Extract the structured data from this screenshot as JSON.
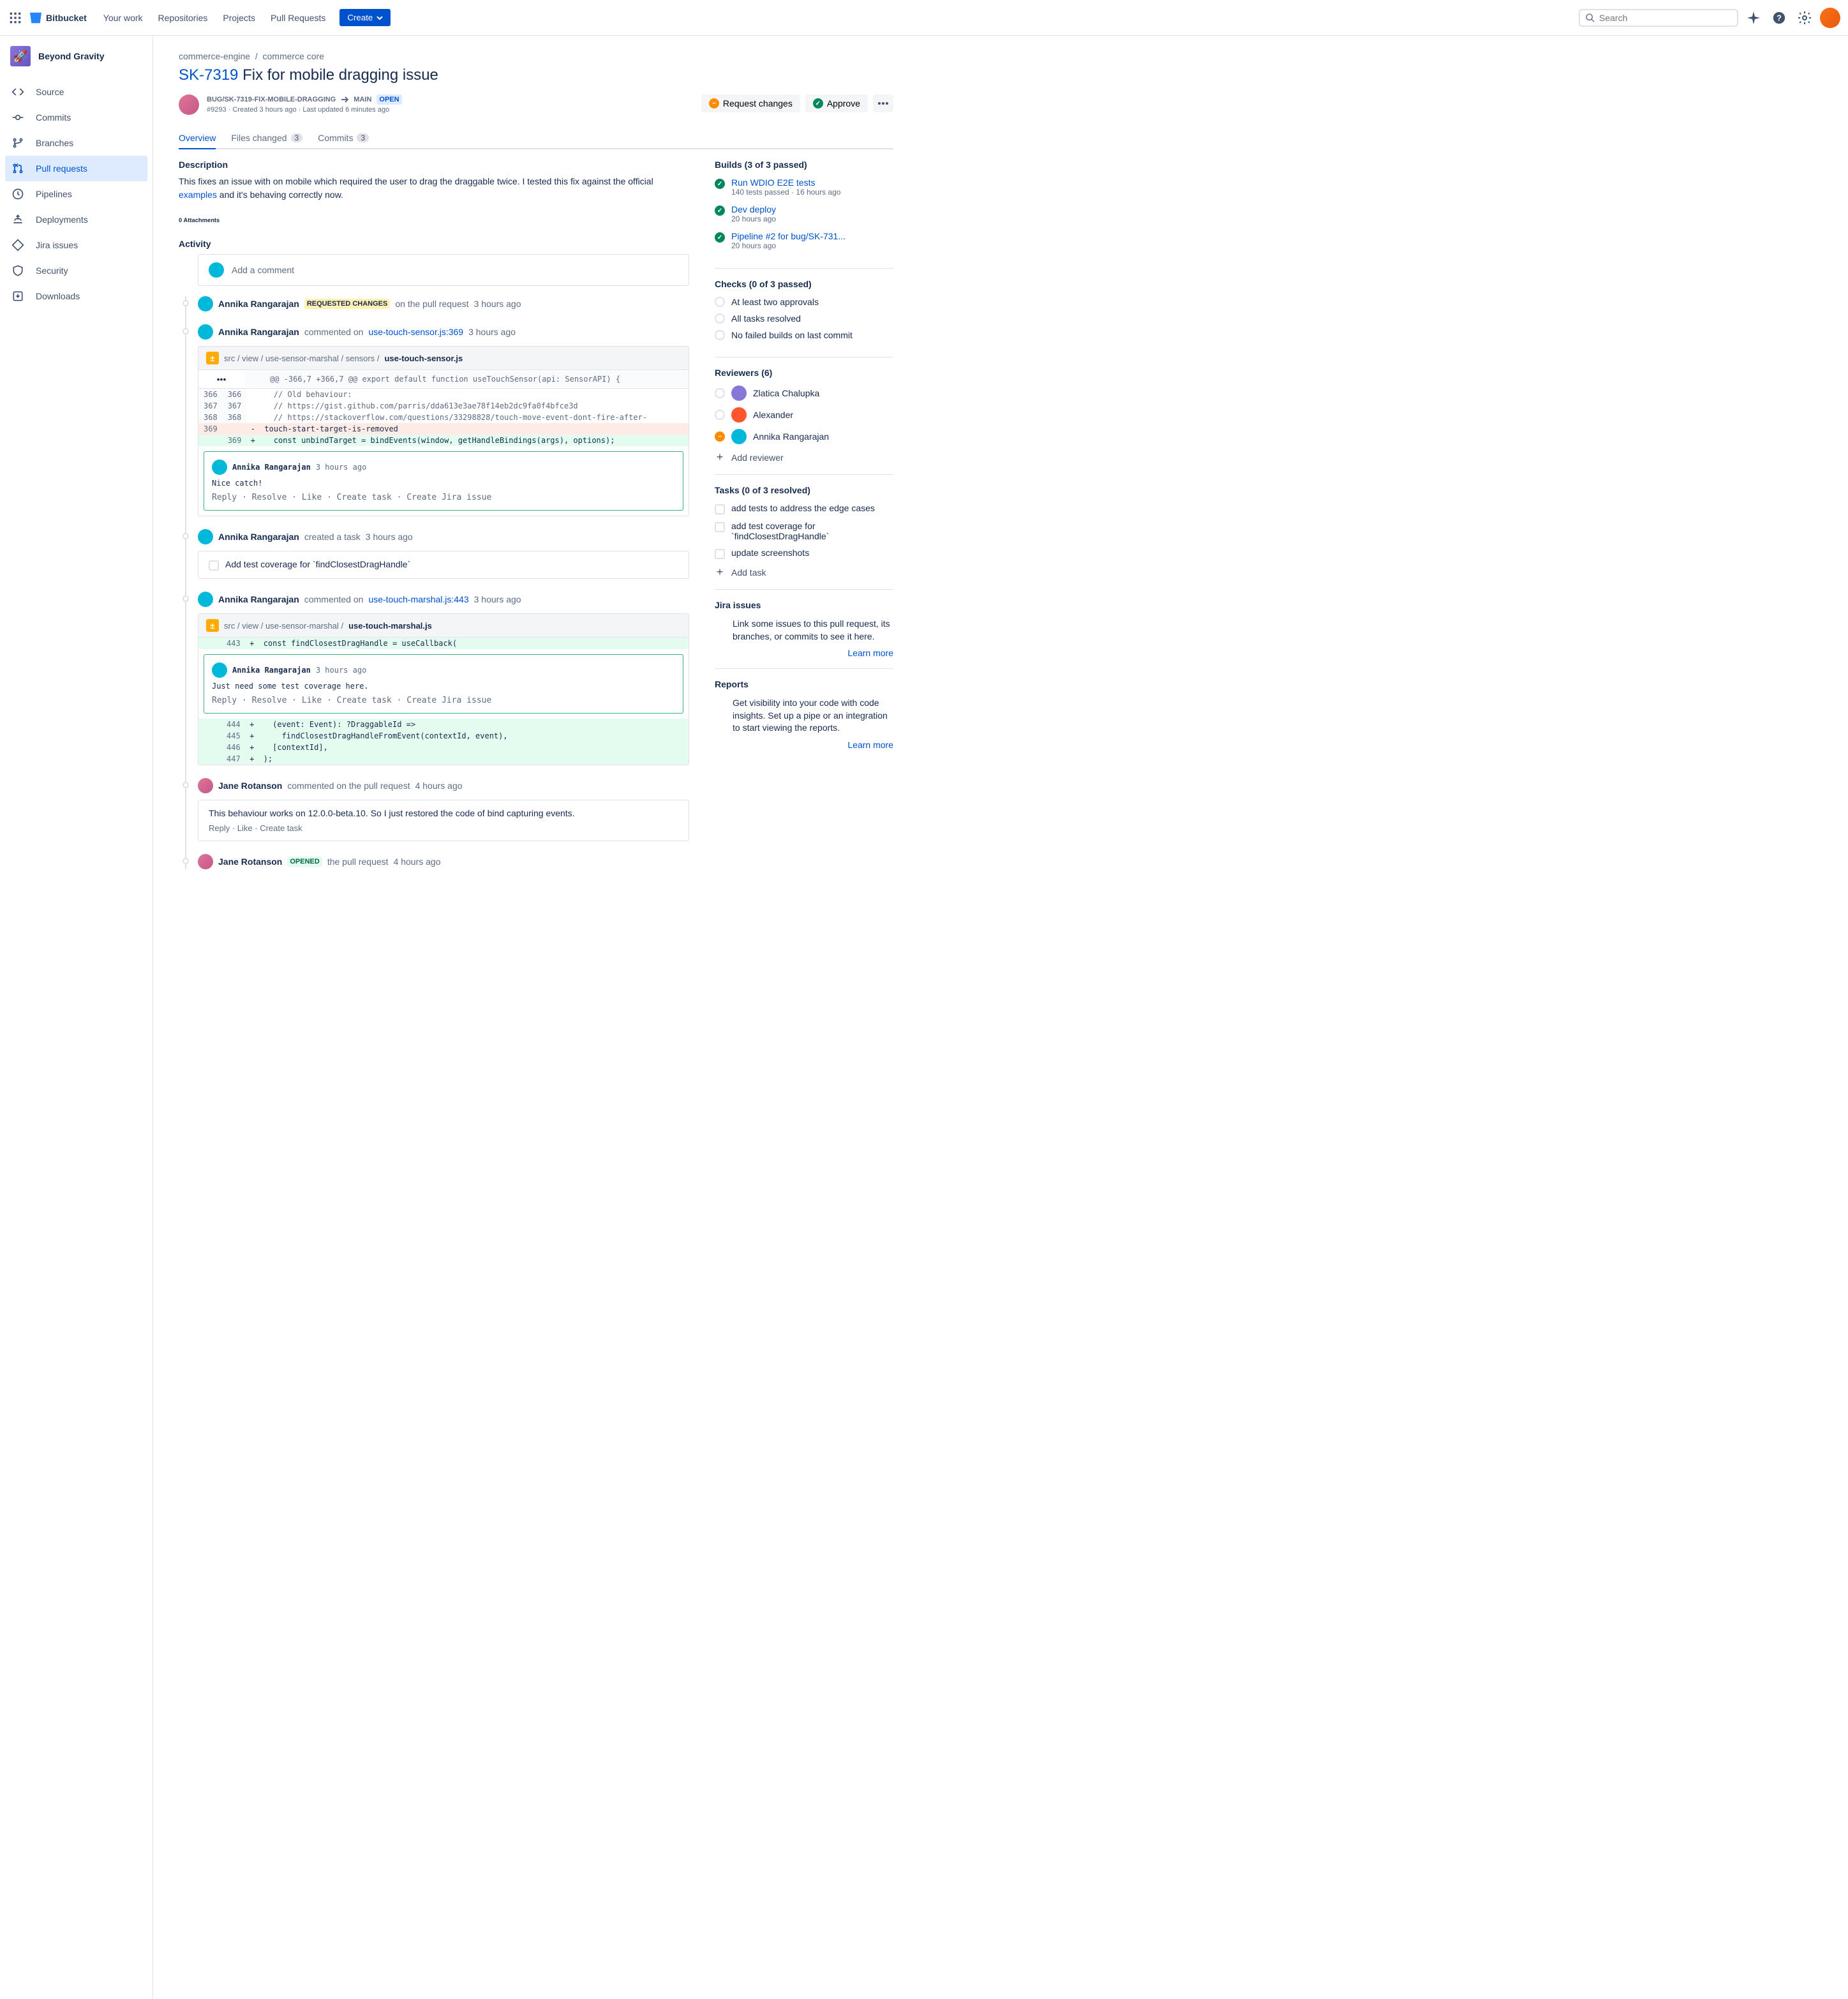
{
  "topnav": {
    "product": "Bitbucket",
    "links": [
      "Your work",
      "Repositories",
      "Projects",
      "Pull Requests"
    ],
    "create": "Create",
    "search_placeholder": "Search"
  },
  "sidebar": {
    "project": "Beyond Gravity",
    "items": [
      {
        "label": "Source",
        "icon": "code"
      },
      {
        "label": "Commits",
        "icon": "commit"
      },
      {
        "label": "Branches",
        "icon": "branch"
      },
      {
        "label": "Pull requests",
        "icon": "pr",
        "active": true
      },
      {
        "label": "Pipelines",
        "icon": "pipeline"
      },
      {
        "label": "Deployments",
        "icon": "deploy"
      },
      {
        "label": "Jira issues",
        "icon": "jira"
      },
      {
        "label": "Security",
        "icon": "security"
      },
      {
        "label": "Downloads",
        "icon": "download"
      }
    ]
  },
  "breadcrumb": {
    "repo": "commerce-engine",
    "pkg": "commerce core"
  },
  "pr": {
    "key": "SK-7319",
    "title": "Fix for mobile dragging issue",
    "branch_source": "BUG/SK-7319-FIX-MOBILE-DRAGGING",
    "branch_dest": "MAIN",
    "state": "OPEN",
    "id_line": "#9293 · Created 3 hours ago · Last updated 6 minutes ago",
    "actions": {
      "request": "Request changes",
      "approve": "Approve"
    }
  },
  "tabs": {
    "overview": "Overview",
    "files": "Files changed",
    "files_count": "3",
    "commits": "Commits",
    "commits_count": "3"
  },
  "description": {
    "heading": "Description",
    "text_pre": "This fixes an issue with on mobile which required the user to drag the draggable twice. I tested this fix against the official ",
    "link": "examples",
    "text_post": " and it's behaving correctly now."
  },
  "attachments": "0 Attachments",
  "activity_heading": "Activity",
  "add_comment": "Add a comment",
  "activity": [
    {
      "author": "Annika Rangarajan",
      "badge": "REQUESTED CHANGES",
      "tail": "on the pull request",
      "time": "3 hours ago"
    },
    {
      "author": "Annika Rangarajan",
      "action": "commented on",
      "link": "use-touch-sensor.js:369",
      "time": "3 hours ago",
      "file_path": "src / view / use-sensor-marshal / sensors / ",
      "file_name": "use-touch-sensor.js",
      "hunk": "@@ -366,7 +366,7 @@ export default function useTouchSensor(api: SensorAPI) {",
      "rows": [
        {
          "l": "366",
          "r": "366",
          "t": "ctx",
          "code": "  // Old behaviour:"
        },
        {
          "l": "367",
          "r": "367",
          "t": "ctx",
          "code": "  // https://gist.github.com/parris/dda613e3ae78f14eb2dc9fa0f4bfce3d"
        },
        {
          "l": "368",
          "r": "368",
          "t": "ctx",
          "code": "  // https://stackoverflow.com/questions/33298828/touch-move-event-dont-fire-after-"
        },
        {
          "l": "369",
          "r": "",
          "t": "del",
          "code": "touch-start-target-is-removed"
        },
        {
          "l": "",
          "r": "369",
          "t": "add",
          "code": "  const unbindTarget = bindEvents(window, getHandleBindings(args), options);"
        }
      ],
      "comment": {
        "author": "Annika Rangarajan",
        "time": "3 hours ago",
        "body": "Nice catch!",
        "actions": "Reply · Resolve · Like · Create task · Create Jira issue"
      }
    },
    {
      "author": "Annika Rangarajan",
      "action": "created a task",
      "time": "3 hours ago",
      "task": "Add test coverage for `findClosestDragHandle`"
    },
    {
      "author": "Annika Rangarajan",
      "action": "commented on",
      "link": "use-touch-marshal.js:443",
      "time": "3 hours ago",
      "file_path": "src / view / use-sensor-marshal / ",
      "file_name": "use-touch-marshal.js",
      "rows2": [
        {
          "l": "",
          "r": "443",
          "t": "add",
          "code": "const findClosestDragHandle = useCallback("
        }
      ],
      "comment": {
        "author": "Annika Rangarajan",
        "time": "3 hours ago",
        "body": "Just need some test coverage here.",
        "actions": "Reply · Resolve · Like · Create task · Create Jira issue"
      },
      "rows3": [
        {
          "l": "",
          "r": "444",
          "t": "add",
          "code": "  (event: Event): ?DraggableId =>"
        },
        {
          "l": "",
          "r": "445",
          "t": "add",
          "code": "    findClosestDragHandleFromEvent(contextId, event),"
        },
        {
          "l": "",
          "r": "446",
          "t": "add",
          "code": "  [contextId],"
        },
        {
          "l": "",
          "r": "447",
          "t": "add",
          "code": ");"
        }
      ]
    },
    {
      "author": "Jane Rotanson",
      "avatar": "jr",
      "action": "commented on the pull request",
      "time": "4 hours ago",
      "plain": {
        "body": "This behaviour works on 12.0.0-beta.10. So I just restored the code of bind capturing events.",
        "actions": "Reply · Like · Create task"
      }
    },
    {
      "author": "Jane Rotanson",
      "avatar": "jr",
      "badge": "OPENED",
      "badge_style": "green",
      "tail": "the pull request",
      "time": "4 hours ago"
    }
  ],
  "builds": {
    "heading": "Builds (3 of 3 passed)",
    "items": [
      {
        "name": "Run WDIO E2E tests",
        "sub": "140 tests passed · 16 hours ago"
      },
      {
        "name": "Dev deploy",
        "sub": "20 hours ago"
      },
      {
        "name": "Pipeline #2 for bug/SK-731...",
        "sub": "20 hours ago"
      }
    ]
  },
  "checks": {
    "heading": "Checks (0 of 3 passed)",
    "items": [
      "At least two approvals",
      "All tasks resolved",
      "No failed builds on last commit"
    ]
  },
  "reviewers": {
    "heading": "Reviewers (6)",
    "items": [
      {
        "name": "Zlatica Chalupka",
        "cls": ""
      },
      {
        "name": "Alexander",
        "cls": "alex"
      },
      {
        "name": "Annika Rangarajan",
        "cls": "ar",
        "status": "requested"
      }
    ],
    "add": "Add reviewer"
  },
  "tasks": {
    "heading": "Tasks (0 of 3 resolved)",
    "items": [
      "add tests to address the edge cases",
      "add test coverage for `findClosestDragHandle`",
      "update screenshots"
    ],
    "add": "Add task"
  },
  "jira": {
    "heading": "Jira issues",
    "text": "Link some issues to this pull request, its branches, or commits to see it here.",
    "learn": "Learn more"
  },
  "reports": {
    "heading": "Reports",
    "text": "Get visibility into your code with code insights. Set up a pipe or an integration to start viewing the reports.",
    "learn": "Learn more"
  }
}
